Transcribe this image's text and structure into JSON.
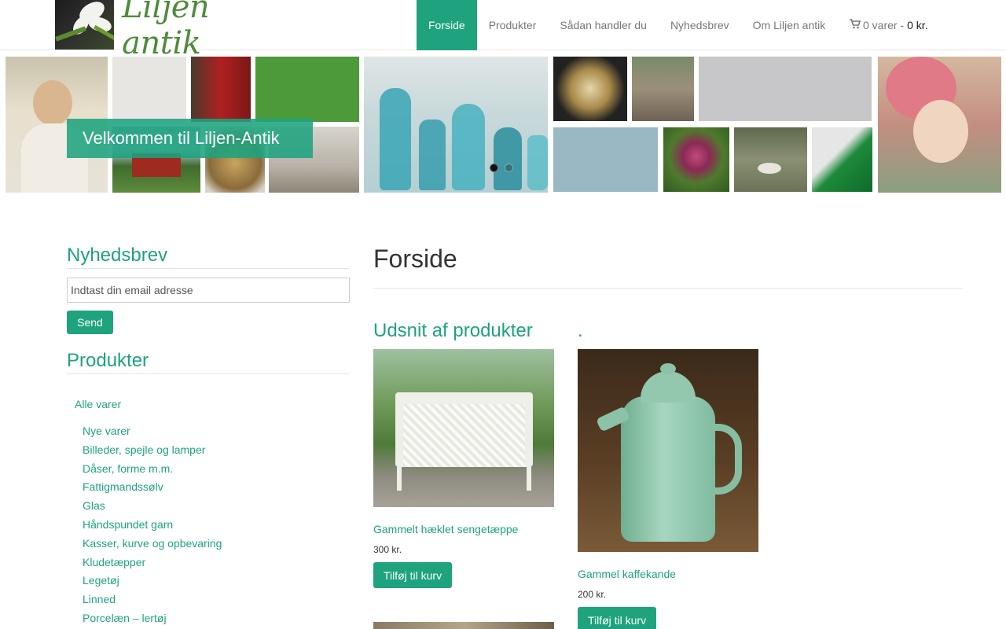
{
  "brand": {
    "name": "Liljen antik"
  },
  "nav": {
    "items": [
      {
        "label": "Forside",
        "active": true
      },
      {
        "label": "Produkter",
        "active": false
      },
      {
        "label": "Sådan handler du",
        "active": false
      },
      {
        "label": "Nyhedsbrev",
        "active": false
      },
      {
        "label": "Om Liljen antik",
        "active": false
      }
    ],
    "cart": {
      "icon": "shopping-cart-icon",
      "items_label": "0 varer -",
      "total": "0 kr."
    }
  },
  "banner": {
    "caption": "Velkommen til Liljen-Antik",
    "slides": 2,
    "active_slide": 1
  },
  "sidebar": {
    "newsletter": {
      "title": "Nyhedsbrev",
      "placeholder": "Indtast din email adresse",
      "button": "Send"
    },
    "products": {
      "title": "Produkter",
      "all_label": "Alle varer",
      "categories": [
        "Nye varer",
        "Billeder, spejle og lamper",
        "Dåser, forme m.m.",
        "Fattigmandssølv",
        "Glas",
        "Håndspundet garn",
        "Kasser, kurve og opbevaring",
        "Kludetæpper",
        "Legetøj",
        "Linned",
        "Porcelæn – lertøj"
      ]
    }
  },
  "main": {
    "title": "Forside",
    "section_title": "Udsnit af produkter",
    "section_title_2": ".",
    "products": [
      {
        "name": "Gammelt hæklet sengetæppe",
        "price": "300 kr.",
        "button": "Tilføj til kurv"
      },
      {
        "name": "Gammel kaffekande",
        "price": "200 kr.",
        "button": "Tilføj til kurv"
      }
    ]
  },
  "colors": {
    "accent": "#1ea37e",
    "logo_green": "#4e8b3a",
    "nav_text": "#777777"
  }
}
